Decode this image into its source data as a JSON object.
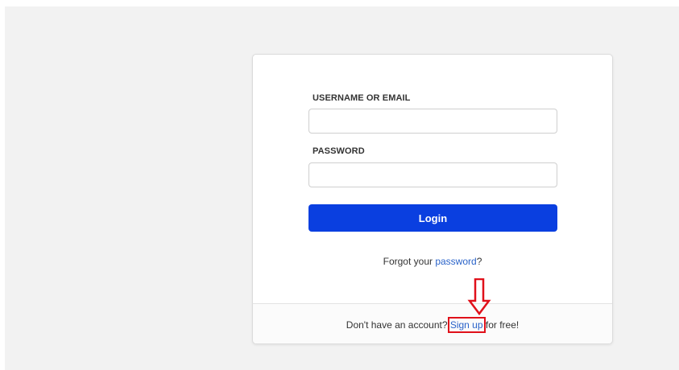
{
  "login_form": {
    "username_label": "USERNAME OR EMAIL",
    "username_value": "",
    "password_label": "PASSWORD",
    "password_value": "",
    "login_button_label": "Login",
    "forgot_prefix": "Forgot your ",
    "forgot_link": "password",
    "forgot_suffix": "?",
    "signup_prefix": "Don't have an account? ",
    "signup_link": "Sign up",
    "signup_suffix": " for free!"
  },
  "annotation": {
    "arrow_icon": "down-arrow-icon",
    "highlight_color": "#e0101a"
  },
  "colors": {
    "primary_button": "#0a3fe0",
    "link": "#2a63c9",
    "background": "#f2f2f2"
  }
}
